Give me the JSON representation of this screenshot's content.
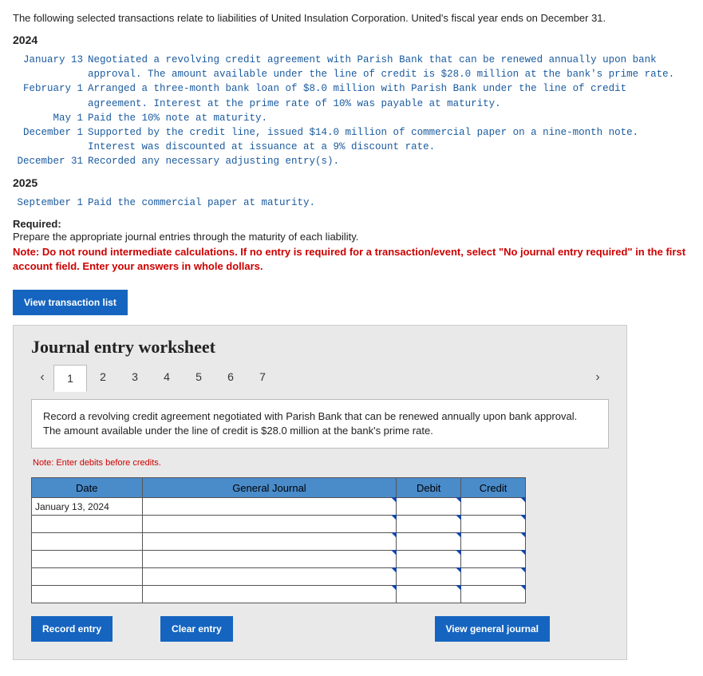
{
  "intro": "The following selected transactions relate to liabilities of United Insulation Corporation. United's fiscal year ends on December 31.",
  "year1": "2024",
  "tx2024": [
    {
      "date": "January 13",
      "desc": "Negotiated a revolving credit agreement with Parish Bank that can be renewed annually upon bank approval. The amount available under the line of credit is $28.0 million at the bank's prime rate."
    },
    {
      "date": "February 1",
      "desc": "Arranged a three-month bank loan of $8.0 million with Parish Bank under the line of credit agreement. Interest at the prime rate of 10% was payable at maturity."
    },
    {
      "date": "May 1",
      "desc": "Paid the 10% note at maturity."
    },
    {
      "date": "December 1",
      "desc": "Supported by the credit line, issued $14.0 million of commercial paper on a nine-month note. Interest was discounted at issuance at a 9% discount rate."
    },
    {
      "date": "December 31",
      "desc": "Recorded any necessary adjusting entry(s)."
    }
  ],
  "year2": "2025",
  "tx2025": [
    {
      "date": "September 1",
      "desc": "Paid the commercial paper at maturity."
    }
  ],
  "required_hdr": "Required:",
  "required_text": "Prepare the appropriate journal entries through the maturity of each liability.",
  "note_red": "Note: Do not round intermediate calculations. If no entry is required for a transaction/event, select \"No journal entry required\" in the first account field. Enter your answers in whole dollars.",
  "view_tx_list": "View transaction list",
  "ws_title": "Journal entry worksheet",
  "tabs": [
    "1",
    "2",
    "3",
    "4",
    "5",
    "6",
    "7"
  ],
  "active_tab_index": 0,
  "entry_desc": "Record a revolving credit agreement negotiated with Parish Bank that can be renewed annually upon bank approval. The amount available under the line of credit is $28.0 million at the bank's prime rate.",
  "note_small": "Note: Enter debits before credits.",
  "table_headers": {
    "date": "Date",
    "gj": "General Journal",
    "debit": "Debit",
    "credit": "Credit"
  },
  "first_date": "January 13, 2024",
  "buttons": {
    "record": "Record entry",
    "clear": "Clear entry",
    "view_gj": "View general journal"
  }
}
